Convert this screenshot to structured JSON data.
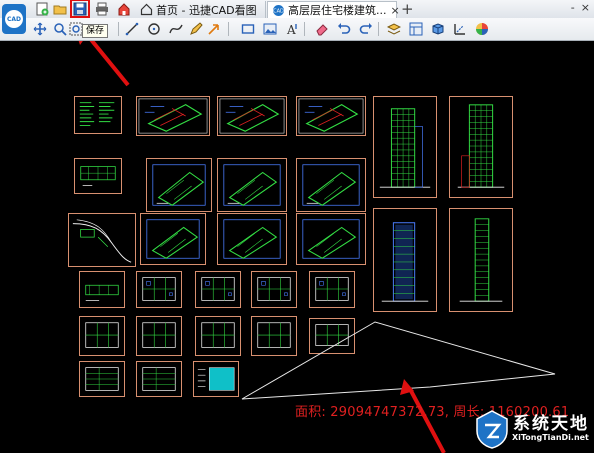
{
  "app": {
    "logo_text": "CAD",
    "tooltip": "保存"
  },
  "tabs": [
    {
      "label": "首页 - 迅捷CAD看图",
      "icon": "home-icon"
    },
    {
      "label": "高层层住宅楼建筑...",
      "icon": "drawing-file-icon",
      "close": "×"
    }
  ],
  "tab_add": "+",
  "window_controls": [
    "-",
    "×"
  ],
  "quick_access": [
    "new-file-icon",
    "open-folder-icon",
    "save-icon",
    "print-icon",
    "home-icon"
  ],
  "toolbar_icons": [
    "pan-icon",
    "zoom-icon",
    "zoom-window-icon",
    "line-icon",
    "circle-icon",
    "curve-icon",
    "pencil-icon",
    "arrow-icon",
    "rectangle-icon",
    "image-icon",
    "text-icon",
    "eraser-icon",
    "undo-icon",
    "redo-icon",
    "layers-icon",
    "layout-icon",
    "3d-view-icon",
    "measure-icon",
    "color-wheel-icon"
  ],
  "status": {
    "measurement": "面积: 29094747372.73, 周长: 1160200.61"
  },
  "watermark": {
    "title": "系统天地",
    "url": "XiTongTianDi.net"
  },
  "colors": {
    "canvas": "#000000",
    "sheet_border": "#d89070",
    "cad_green": "#33dd44",
    "cad_blue": "#4a7dff",
    "annotation_red": "#e02020",
    "highlight_red": "#e01010",
    "logo_blue": "#1e73c6"
  }
}
